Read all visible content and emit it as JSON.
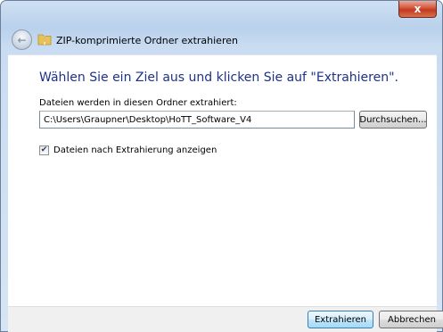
{
  "window": {
    "close_label": "x",
    "title": "ZIP-komprimierte Ordner extrahieren",
    "back_icon": "back-arrow-icon",
    "title_icon": "zip-folder-icon"
  },
  "main": {
    "heading": "Wählen Sie ein Ziel aus und klicken Sie auf \"Extrahieren\".",
    "field_label": "Dateien werden in diesen Ordner extrahiert:",
    "path_value": "C:\\Users\\Graupner\\Desktop\\HoTT_Software_V4",
    "browse_label": "Durchsuchen...",
    "checkbox_label": "Dateien nach Extrahierung anzeigen",
    "checkbox_checked": true
  },
  "footer": {
    "extract_label": "Extrahieren",
    "cancel_label": "Abbrechen"
  },
  "colors": {
    "heading": "#1e3287",
    "close_button": "#c23a1f"
  }
}
